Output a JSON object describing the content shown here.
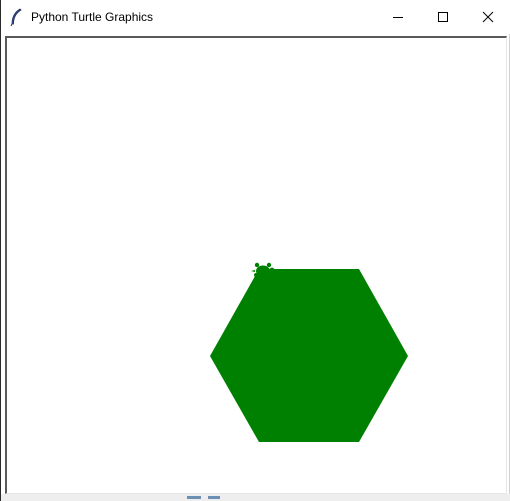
{
  "window": {
    "title": "Python Turtle Graphics",
    "app_icon": "feather-icon",
    "controls": {
      "minimize_icon": "minimize-icon",
      "maximize_icon": "maximize-icon",
      "close_icon": "close-icon"
    }
  },
  "canvas": {
    "background": "#ffffff",
    "shape_fill_color": "#008000",
    "turtle_color": "#008000",
    "shape": "filled-hexagon",
    "cursor_icon": "turtle-icon"
  }
}
